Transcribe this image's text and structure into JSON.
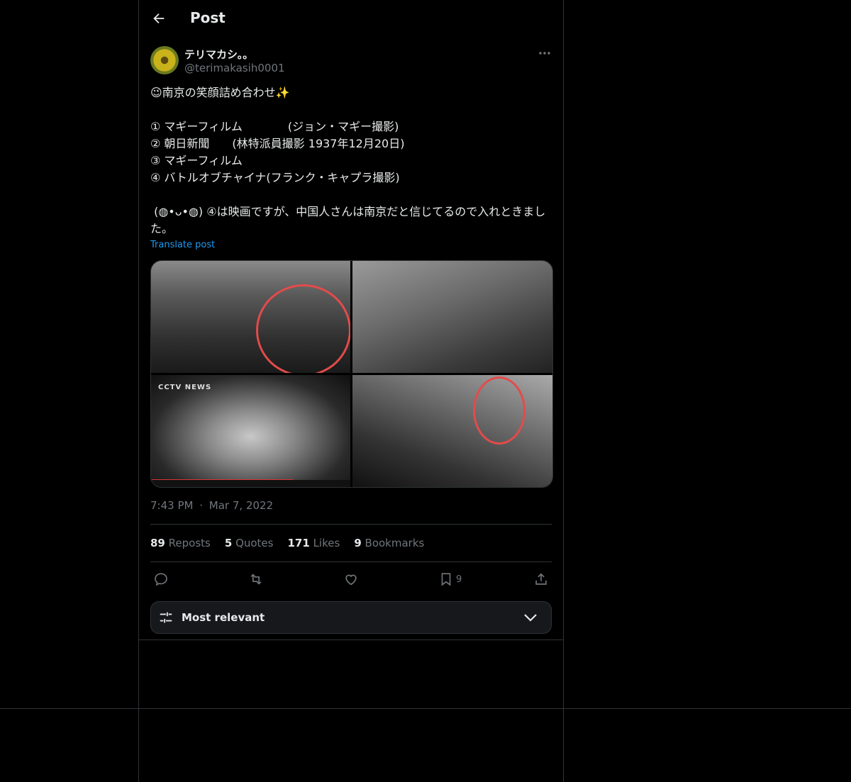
{
  "header": {
    "title": "Post"
  },
  "author": {
    "name": "テリマカシ。。",
    "handle": "@terimakasih0001"
  },
  "post": {
    "text": "😉南京の笑顔詰め合わせ✨\n\n① マギーフィルム　　　　(ジョン・マギー撮影)\n② 朝日新聞　　(林特派員撮影 1937年12月20日)\n③ マギーフィルム\n④ バトルオブチャイナ(フランク・キャプラ撮影)\n\n (◍•ᴗ•◍) ④は映画ですが、中国人さんは南京だと信じてるので入れときました。",
    "translate_label": "Translate post",
    "media_badge": "CCTV NEWS",
    "timestamp": "7:43 PM",
    "date": "Mar 7, 2022",
    "separator": "·"
  },
  "stats": [
    {
      "count": "89",
      "label": "Reposts"
    },
    {
      "count": "5",
      "label": "Quotes"
    },
    {
      "count": "171",
      "label": "Likes"
    },
    {
      "count": "9",
      "label": "Bookmarks"
    }
  ],
  "actions": {
    "bookmark_count": "9"
  },
  "replies_sort": {
    "label": "Most relevant"
  },
  "colors": {
    "background": "#000000",
    "text": "#e7e9ea",
    "muted": "#71767b",
    "link": "#1d9bf0",
    "border": "#2f3336"
  }
}
